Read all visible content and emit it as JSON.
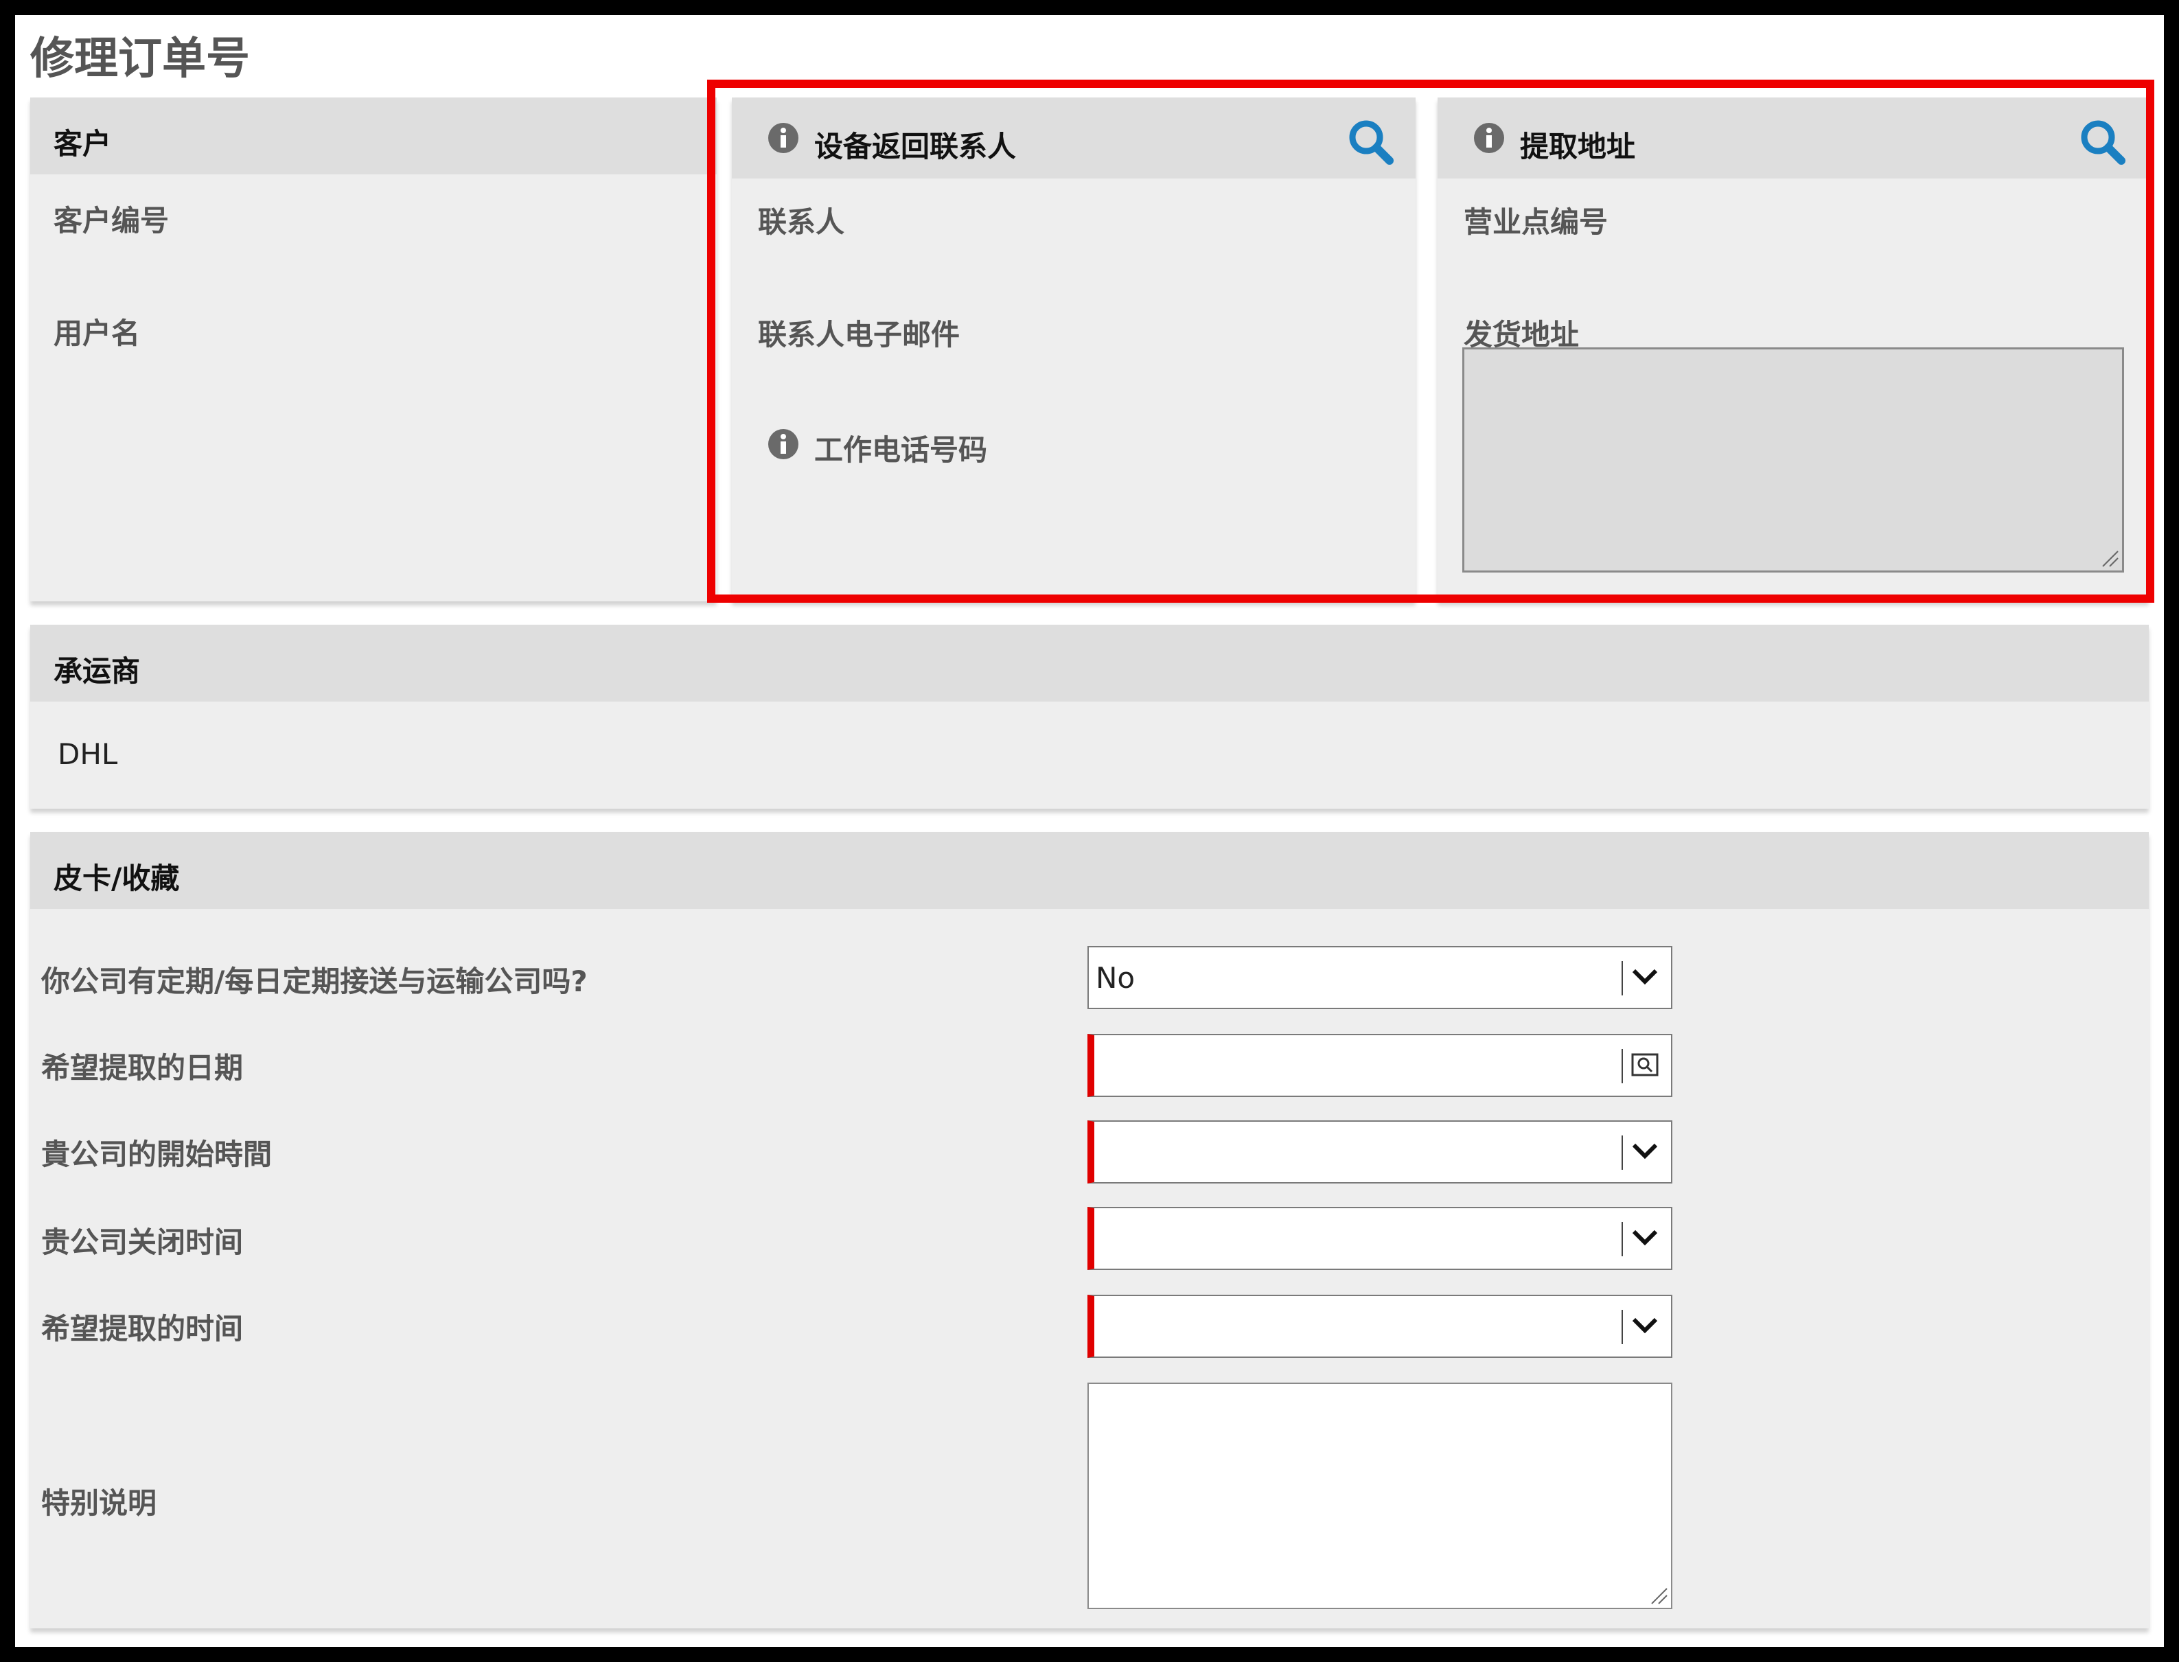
{
  "page": {
    "title": "修理订单号"
  },
  "customer": {
    "header": "客户",
    "customer_number_label": "客户编号",
    "username_label": "用户名"
  },
  "return_contact": {
    "header": "设备返回联系人",
    "contact_label": "联系人",
    "email_label": "联系人电子邮件",
    "phone_label": "工作电话号码",
    "info_icon": "info-icon",
    "search_icon": "search-icon"
  },
  "pickup_address": {
    "header": "提取地址",
    "site_number_label": "营业点编号",
    "ship_address_label": "发货地址",
    "ship_address_value": "",
    "info_icon": "info-icon",
    "search_icon": "search-icon"
  },
  "carrier": {
    "header": "承运商",
    "value": "DHL"
  },
  "pickup": {
    "header": "皮卡/收藏",
    "fields": [
      {
        "label": "你公司有定期/每日定期接送与运输公司吗?",
        "value": "No",
        "type": "select",
        "required": false
      },
      {
        "label": "希望提取的日期",
        "value": "",
        "type": "date",
        "required": true
      },
      {
        "label": "貴公司的開始時間",
        "value": "",
        "type": "select",
        "required": true
      },
      {
        "label": "贵公司关闭时间",
        "value": "",
        "type": "select",
        "required": true
      },
      {
        "label": "希望提取的时间",
        "value": "",
        "type": "select",
        "required": true
      }
    ],
    "special_instructions_label": "特别说明",
    "special_instructions_value": ""
  },
  "colors": {
    "accent_search": "#1a7fc1",
    "required_marker": "#e00000",
    "highlight_box": "#ee0000",
    "panel_bg": "#eeeeee",
    "panel_header_bg": "#dedede"
  }
}
